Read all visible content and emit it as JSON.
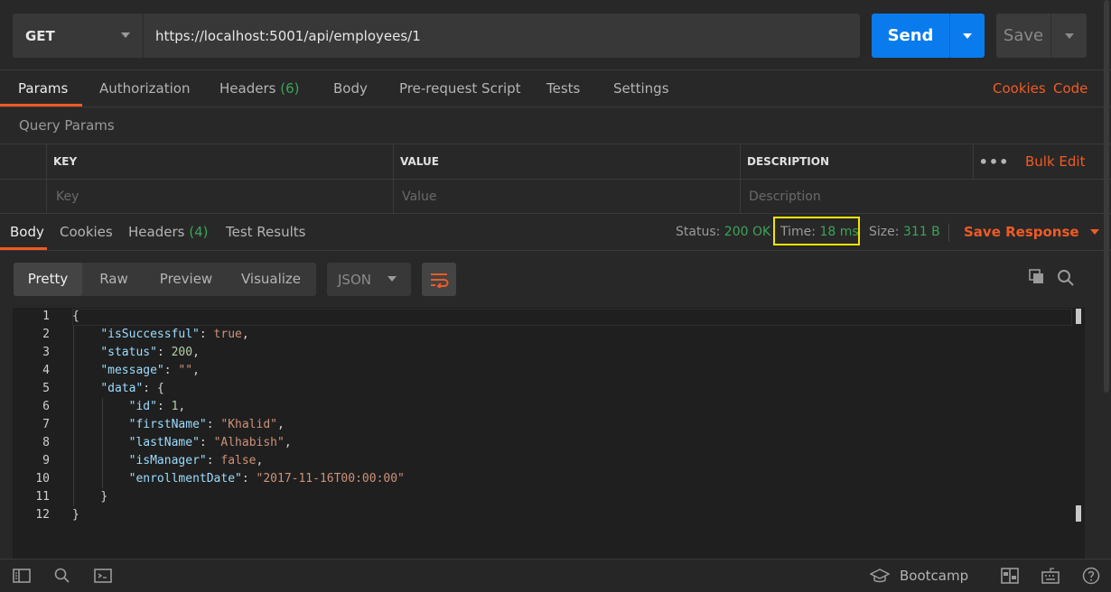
{
  "request": {
    "method": "GET",
    "url": "https://localhost:5001/api/employees/1",
    "send_label": "Send",
    "save_label": "Save"
  },
  "req_tabs": {
    "params": "Params",
    "authorization": "Authorization",
    "headers": "Headers",
    "headers_count": "(6)",
    "body": "Body",
    "prerequest": "Pre-request Script",
    "tests": "Tests",
    "settings": "Settings",
    "cookies": "Cookies",
    "code": "Code"
  },
  "query_params": {
    "title": "Query Params",
    "col_key": "KEY",
    "col_value": "VALUE",
    "col_description": "DESCRIPTION",
    "bulk_edit": "Bulk Edit",
    "key_placeholder": "Key",
    "value_placeholder": "Value",
    "description_placeholder": "Description"
  },
  "response": {
    "tabs": {
      "body": "Body",
      "cookies": "Cookies",
      "headers": "Headers",
      "headers_count": "(4)",
      "test_results": "Test Results"
    },
    "status_label": "Status:",
    "status_value": "200 OK",
    "time_label": "Time:",
    "time_value": "18 ms",
    "size_label": "Size:",
    "size_value": "311 B",
    "save_response": "Save Response"
  },
  "view": {
    "pretty": "Pretty",
    "raw": "Raw",
    "preview": "Preview",
    "visualize": "Visualize",
    "format": "JSON"
  },
  "code_lines": [
    {
      "n": "1"
    },
    {
      "n": "2"
    },
    {
      "n": "3"
    },
    {
      "n": "4"
    },
    {
      "n": "5"
    },
    {
      "n": "6"
    },
    {
      "n": "7"
    },
    {
      "n": "8"
    },
    {
      "n": "9"
    },
    {
      "n": "10"
    },
    {
      "n": "11"
    },
    {
      "n": "12"
    }
  ],
  "json_body": {
    "open": "{",
    "close": "}",
    "k_isSuccessful": "\"isSuccessful\"",
    "v_isSuccessful": "true",
    "k_status": "\"status\"",
    "v_status": "200",
    "k_message": "\"message\"",
    "v_message": "\"\"",
    "k_data": "\"data\"",
    "k_id": "\"id\"",
    "v_id": "1",
    "k_firstName": "\"firstName\"",
    "v_firstName": "\"Khalid\"",
    "k_lastName": "\"lastName\"",
    "v_lastName": "\"Alhabish\"",
    "k_isManager": "\"isManager\"",
    "v_isManager": "false",
    "k_enrollmentDate": "\"enrollmentDate\"",
    "v_enrollmentDate": "\"2017-11-16T00:00:00\""
  },
  "footer": {
    "bootcamp": "Bootcamp"
  },
  "colors": {
    "accent_orange": "#ef5b25",
    "send_blue": "#097bed",
    "ok_green": "#3ea35a",
    "highlight_yellow": "#f4e600"
  }
}
